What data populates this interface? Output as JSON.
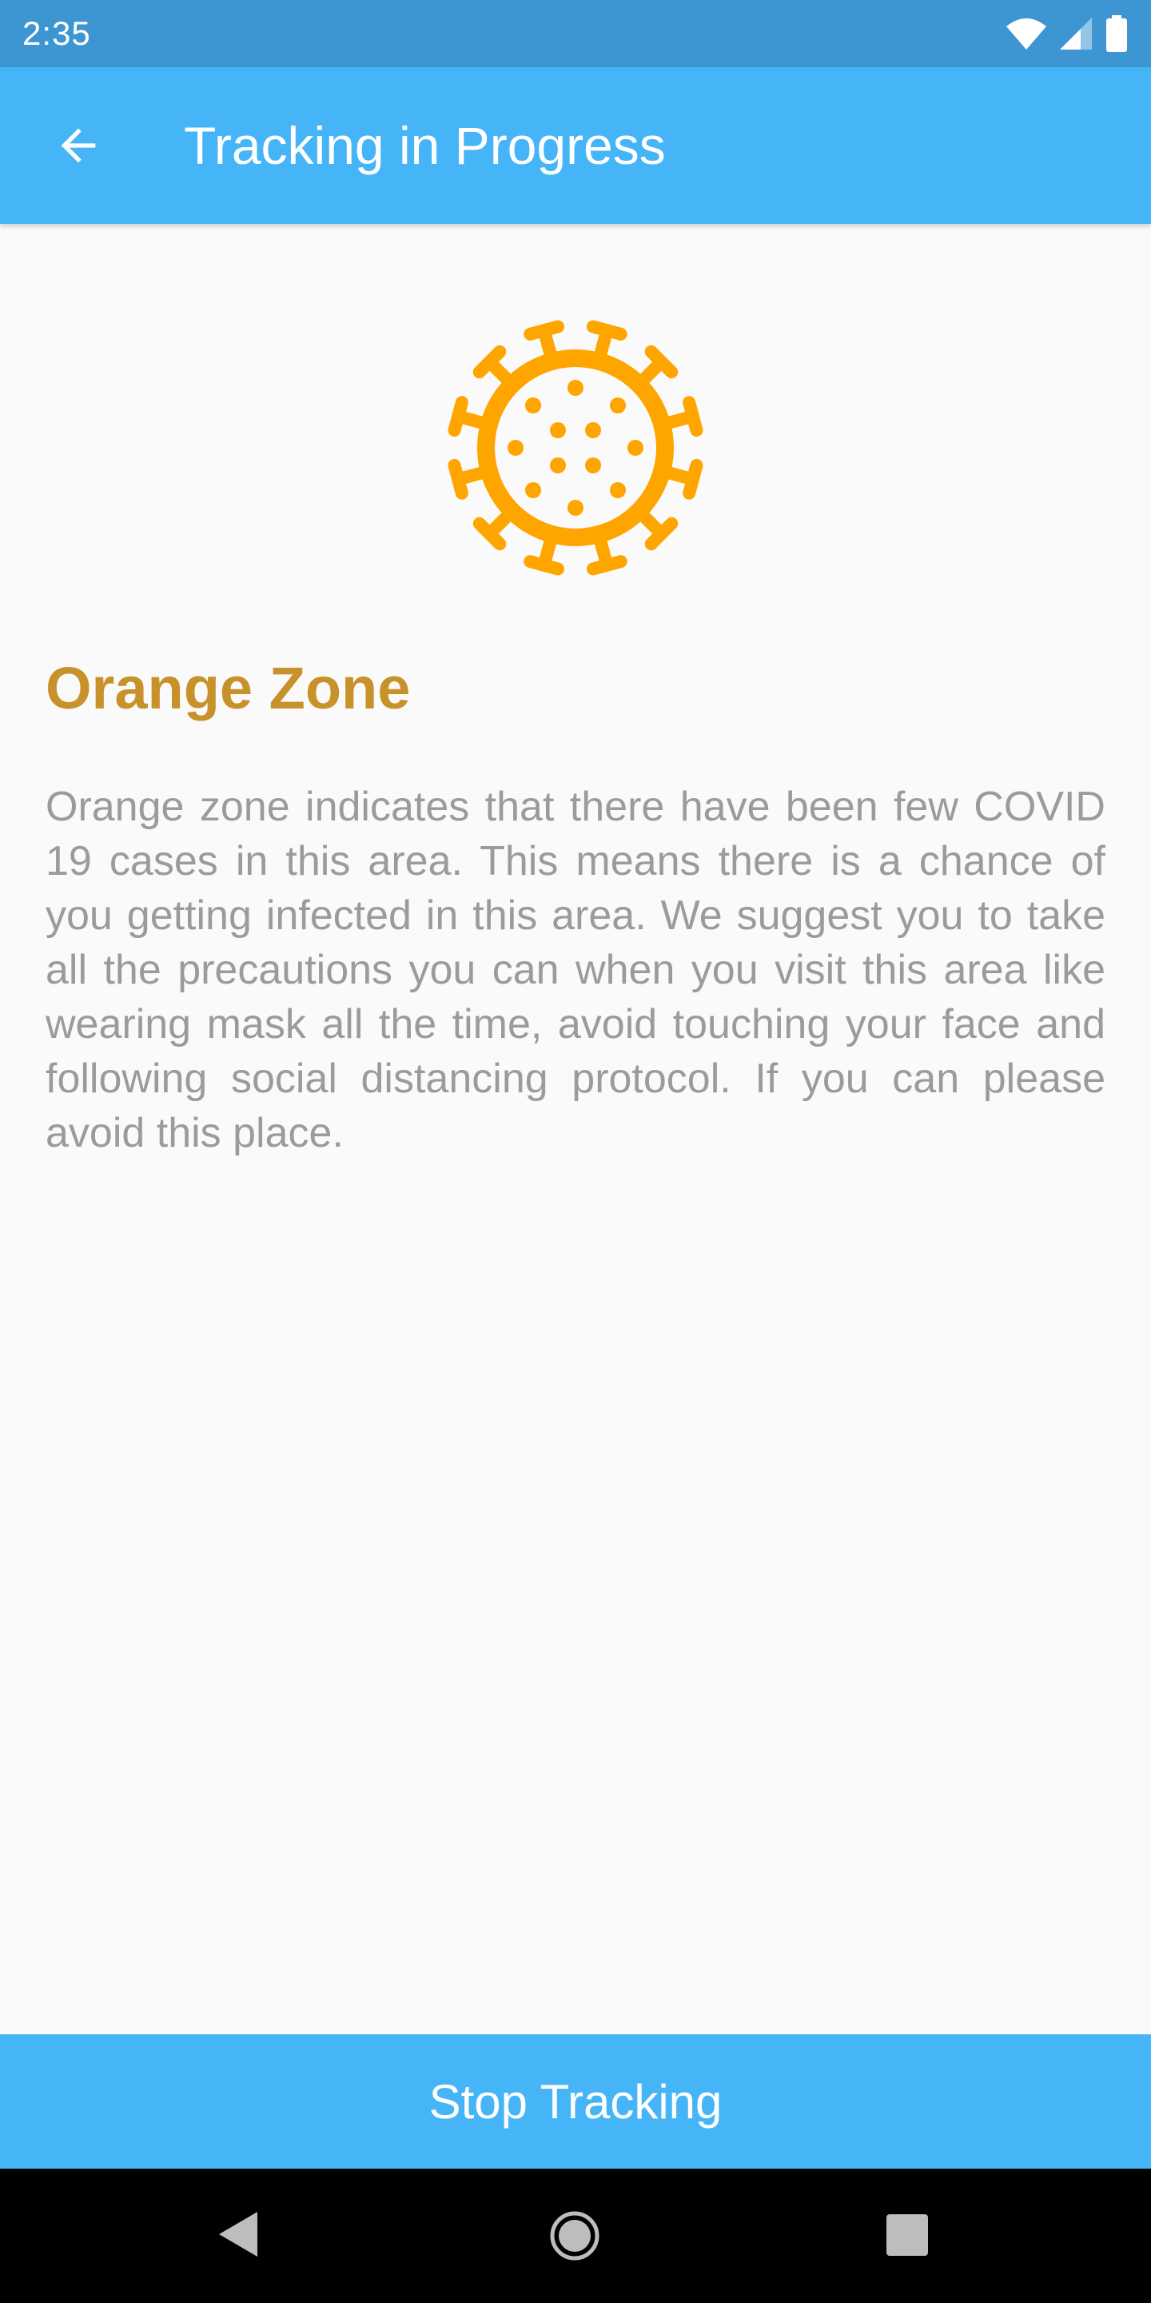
{
  "status_bar": {
    "time": "2:35",
    "icons": [
      "wifi-icon",
      "cellular-signal-icon",
      "battery-icon"
    ]
  },
  "app_bar": {
    "title": "Tracking in Progress",
    "back_icon": "arrow-back-icon",
    "color": "#46b5f7"
  },
  "zone": {
    "icon": "virus-icon",
    "icon_color": "#ffa500",
    "title": "Orange Zone",
    "title_color": "#c8922a",
    "description": "Orange zone indicates that there have been few COVID 19 cases in this area. This means there is a chance of you getting infected in this area. We suggest you to take all the precautions you can when you visit this area like wearing mask all the time, avoid touching your face and following social distancing protocol. If you can please avoid this place."
  },
  "actions": {
    "stop_label": "Stop Tracking"
  },
  "nav_bar": {
    "icons": [
      "nav-back-icon",
      "nav-home-icon",
      "nav-recents-icon"
    ]
  }
}
